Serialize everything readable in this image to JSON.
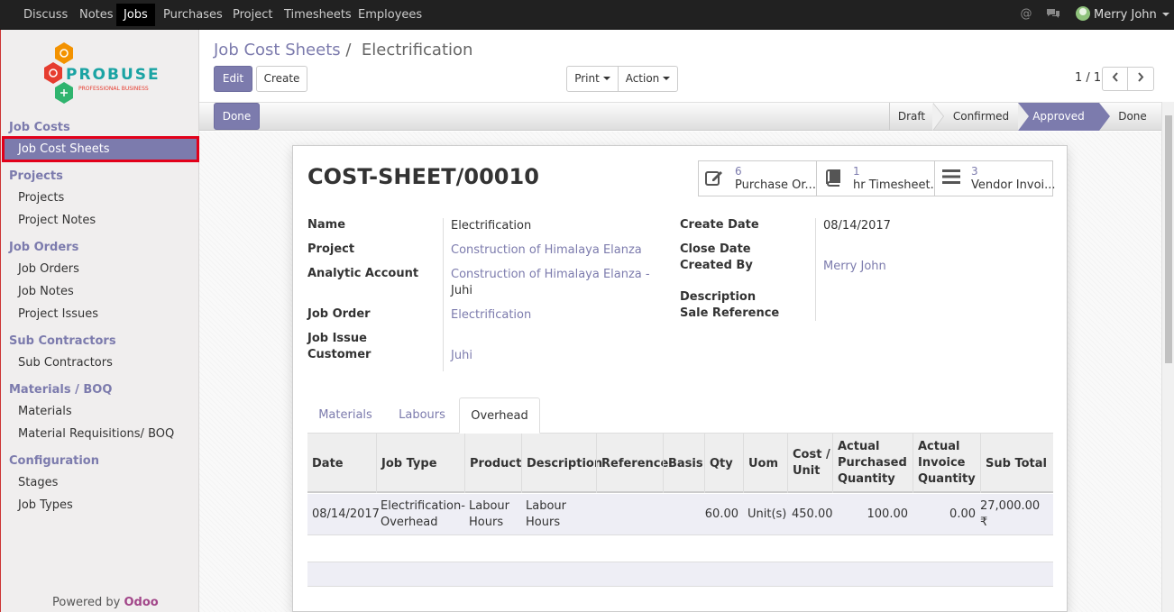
{
  "topbar": {
    "menus": [
      "Discuss",
      "Notes",
      "Jobs",
      "Purchases",
      "Project",
      "Timesheets",
      "Employees"
    ],
    "active_menu": "Jobs",
    "user_name": "Merry John"
  },
  "sidebar": {
    "logo_text": "PROBUSE",
    "logo_tagline": "PROFESSIONAL BUSINESS",
    "sections": [
      {
        "title": "Job Costs",
        "items": [
          "Job Cost Sheets"
        ]
      },
      {
        "title": "Projects",
        "items": [
          "Projects",
          "Project Notes"
        ]
      },
      {
        "title": "Job Orders",
        "items": [
          "Job Orders",
          "Job Notes",
          "Project Issues"
        ]
      },
      {
        "title": "Sub Contractors",
        "items": [
          "Sub Contractors"
        ]
      },
      {
        "title": "Materials / BOQ",
        "items": [
          "Materials",
          "Material Requisitions/ BOQ"
        ]
      },
      {
        "title": "Configuration",
        "items": [
          "Stages",
          "Job Types"
        ]
      }
    ],
    "active_item": "Job Cost Sheets",
    "powered_by": "Powered by",
    "powered_brand": "Odoo"
  },
  "breadcrumb": {
    "parent": "Job Cost Sheets",
    "separator": "/",
    "current": "Electrification"
  },
  "toolbar": {
    "edit": "Edit",
    "create": "Create",
    "print": "Print",
    "action": "Action",
    "pager": "1 / 1"
  },
  "statusbar": {
    "done_button": "Done",
    "stages": [
      "Draft",
      "Confirmed",
      "Approved",
      "Done"
    ],
    "active_stage": "Approved"
  },
  "record": {
    "title": "COST-SHEET/00010",
    "smart_buttons": [
      {
        "count": "6",
        "label": "Purchase Or...",
        "icon": "pencil-square-icon"
      },
      {
        "count": "1",
        "label": "hr Timesheet...",
        "icon": "book-icon"
      },
      {
        "count": "3",
        "label": "Vendor Invoi...",
        "icon": "list-icon"
      }
    ],
    "left_fields": {
      "name_label": "Name",
      "name": "Electrification",
      "project_label": "Project",
      "project": "Construction of Himalaya Elanza",
      "analytic_label": "Analytic Account",
      "analytic_line1": "Construction of Himalaya Elanza -",
      "analytic_line2": "Juhi",
      "job_order_label": "Job Order",
      "job_order": "Electrification",
      "job_issue_label": "Job Issue",
      "customer_label": "Customer",
      "customer": "Juhi"
    },
    "right_fields": {
      "create_date_label": "Create Date",
      "create_date": "08/14/2017",
      "close_date_label": "Close Date",
      "created_by_label": "Created By",
      "created_by": "Merry John",
      "description_label": "Description",
      "sale_ref_label": "Sale Reference"
    }
  },
  "tabs": [
    "Materials",
    "Labours",
    "Overhead"
  ],
  "active_tab": "Overhead",
  "table": {
    "headers": [
      "Date",
      "Job Type",
      "Product",
      "Description",
      "Reference",
      "Basis",
      "Qty",
      "Uom",
      "Cost / Unit",
      "Actual Purchased Quantity",
      "Actual Invoice Quantity",
      "Sub Total"
    ],
    "rows": [
      {
        "date": "08/14/2017",
        "job_type": "Electrification-Overhead",
        "product": "Labour Hours",
        "description": "Labour Hours",
        "reference": "",
        "basis": "",
        "qty": "60.00",
        "uom": "Unit(s)",
        "cost": "450.00",
        "purchased": "100.00",
        "invoice": "0.00",
        "subtotal": "27,000.00 ₹"
      }
    ]
  },
  "colors": {
    "accent": "#7c7bad",
    "topbar": "#212121",
    "highlight_border": "#e2001a"
  }
}
